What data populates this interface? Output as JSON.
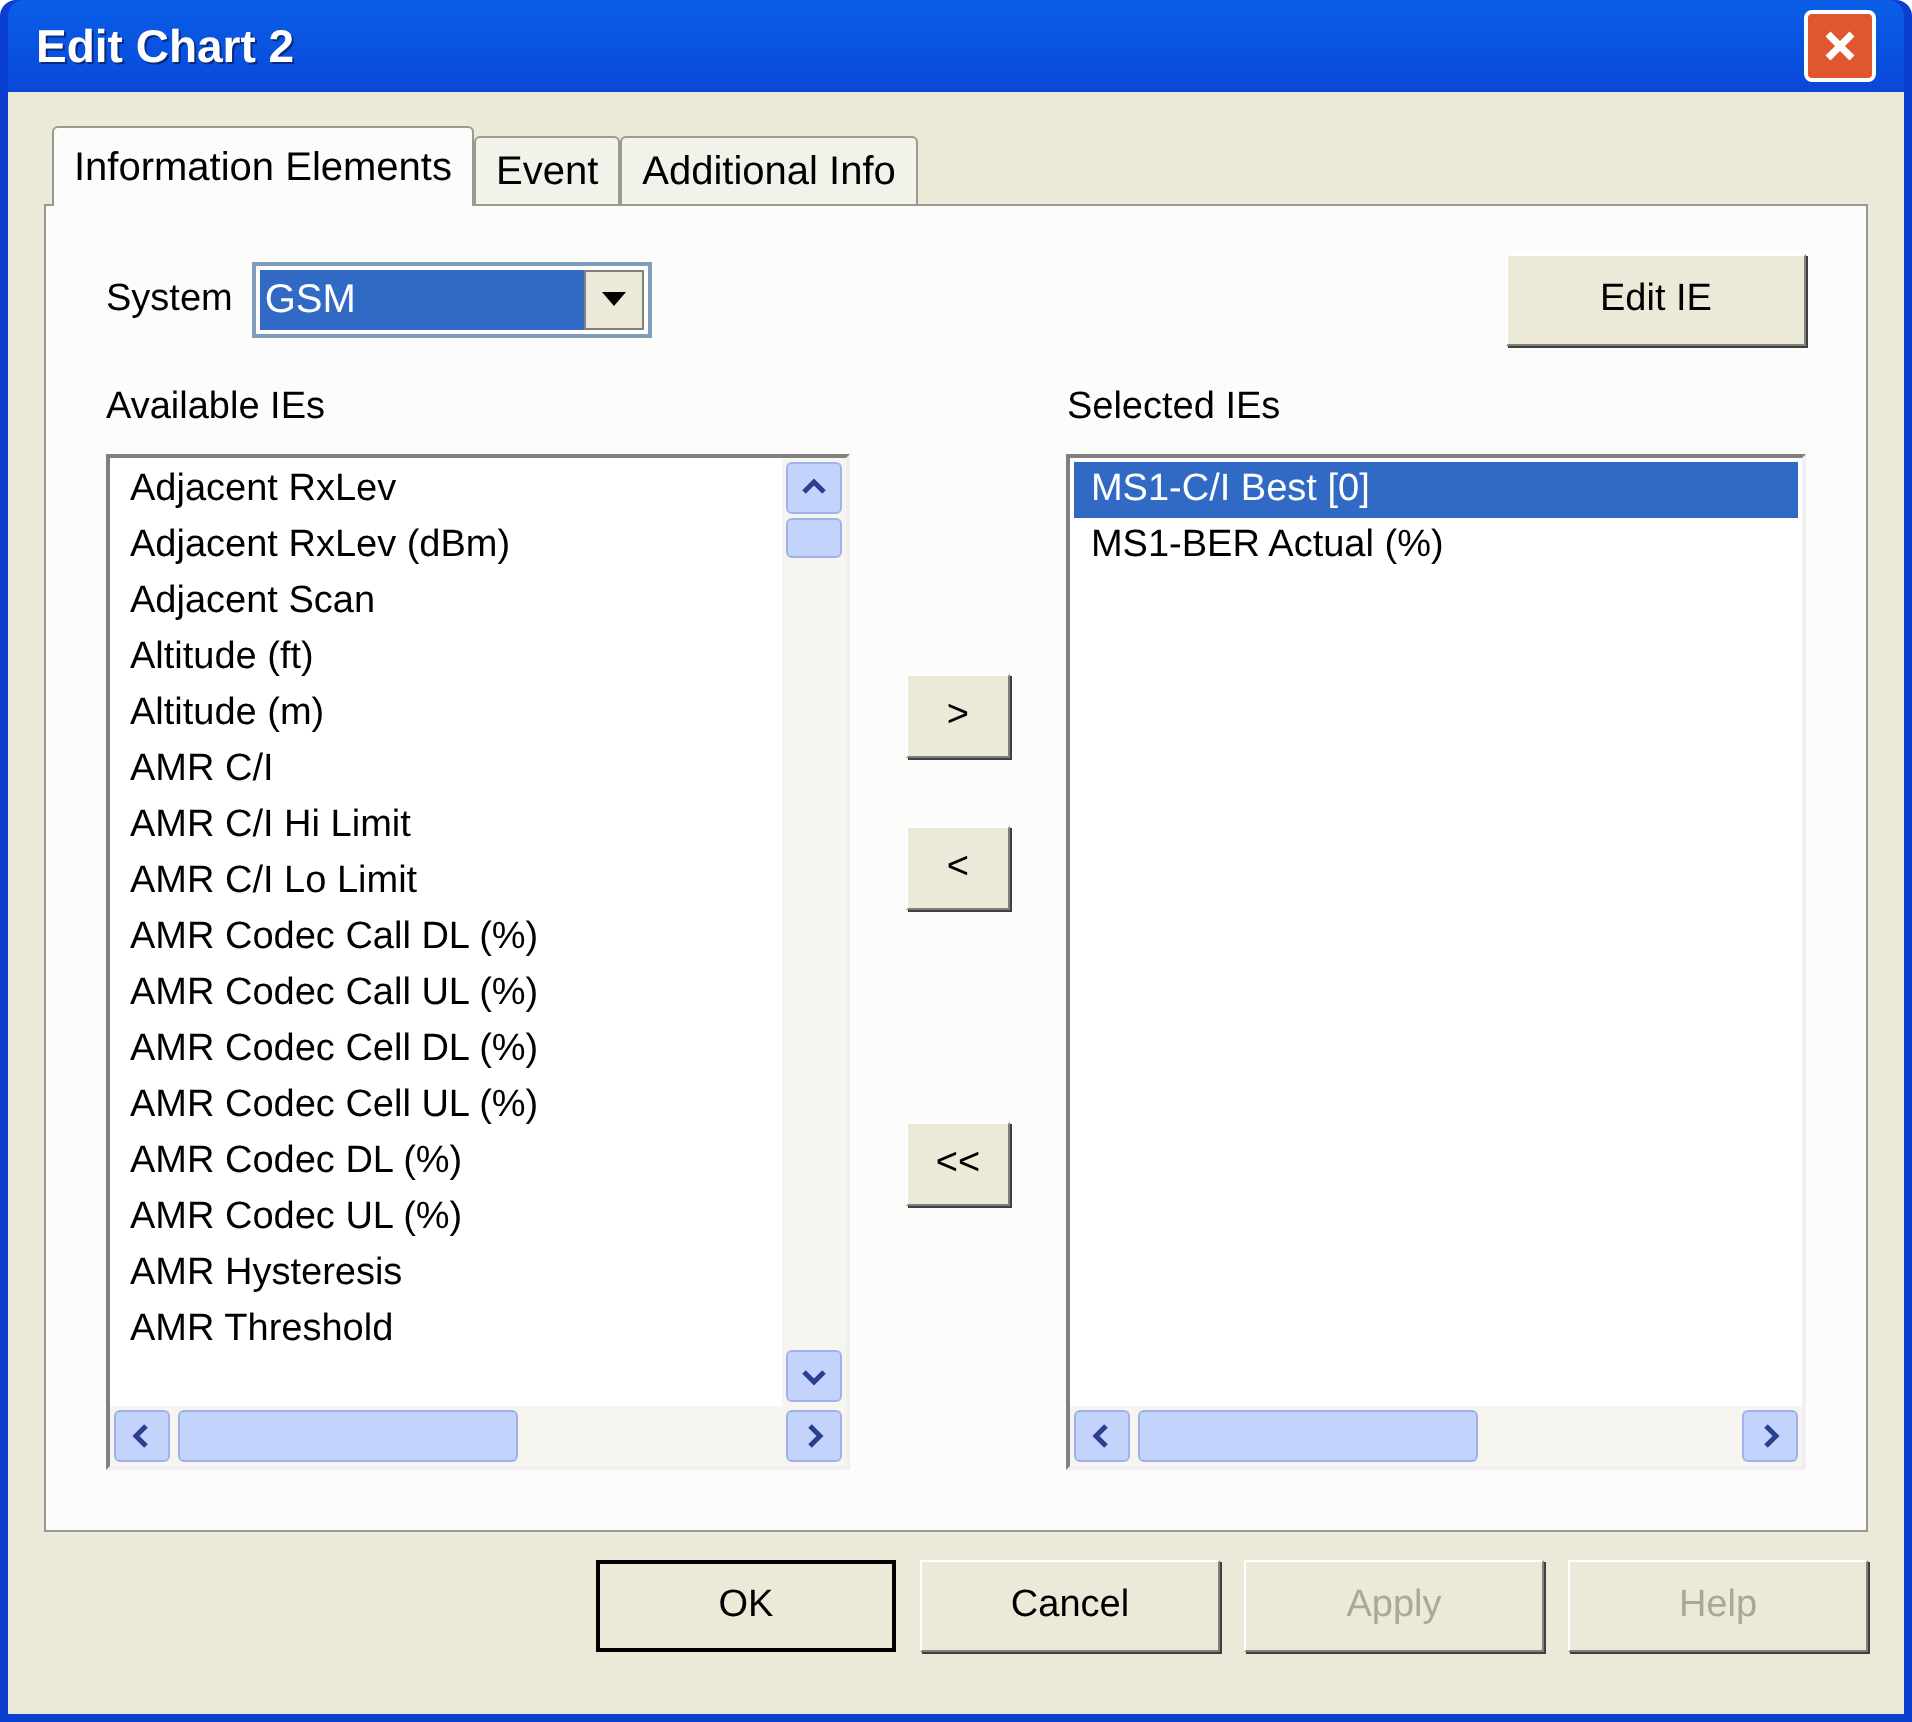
{
  "window": {
    "title": "Edit Chart 2"
  },
  "tabs": [
    {
      "label": "Information Elements",
      "selected": true
    },
    {
      "label": "Event",
      "selected": false
    },
    {
      "label": "Additional Info",
      "selected": false
    }
  ],
  "system": {
    "label": "System",
    "value": "GSM"
  },
  "edit_ie_button": "Edit IE",
  "available": {
    "label": "Available IEs",
    "items": [
      {
        "text": "Adjacent RxLev",
        "selected": false
      },
      {
        "text": "Adjacent RxLev (dBm)",
        "selected": false
      },
      {
        "text": "Adjacent Scan",
        "selected": false
      },
      {
        "text": "Altitude (ft)",
        "selected": false
      },
      {
        "text": "Altitude (m)",
        "selected": false
      },
      {
        "text": "AMR C/I",
        "selected": false
      },
      {
        "text": "AMR C/I Hi Limit",
        "selected": false
      },
      {
        "text": "AMR C/I Lo Limit",
        "selected": false
      },
      {
        "text": "AMR Codec Call DL (%)",
        "selected": false
      },
      {
        "text": "AMR Codec Call UL (%)",
        "selected": false
      },
      {
        "text": "AMR Codec Cell DL (%)",
        "selected": false
      },
      {
        "text": "AMR Codec Cell UL (%)",
        "selected": false
      },
      {
        "text": "AMR Codec DL (%)",
        "selected": false
      },
      {
        "text": "AMR Codec UL (%)",
        "selected": false
      },
      {
        "text": "AMR Hysteresis",
        "selected": false
      },
      {
        "text": "AMR Threshold",
        "selected": false
      }
    ]
  },
  "move_buttons": [
    ">",
    "<",
    "<<"
  ],
  "selected_ies": {
    "label": "Selected IEs",
    "items": [
      {
        "text": "MS1-C/I Best [0]",
        "selected": true
      },
      {
        "text": "MS1-BER Actual (%)",
        "selected": false
      }
    ]
  },
  "buttons": [
    {
      "label": "OK",
      "disabled": false,
      "default": true
    },
    {
      "label": "Cancel",
      "disabled": false,
      "default": false
    },
    {
      "label": "Apply",
      "disabled": true,
      "default": false
    },
    {
      "label": "Help",
      "disabled": true,
      "default": false
    }
  ]
}
